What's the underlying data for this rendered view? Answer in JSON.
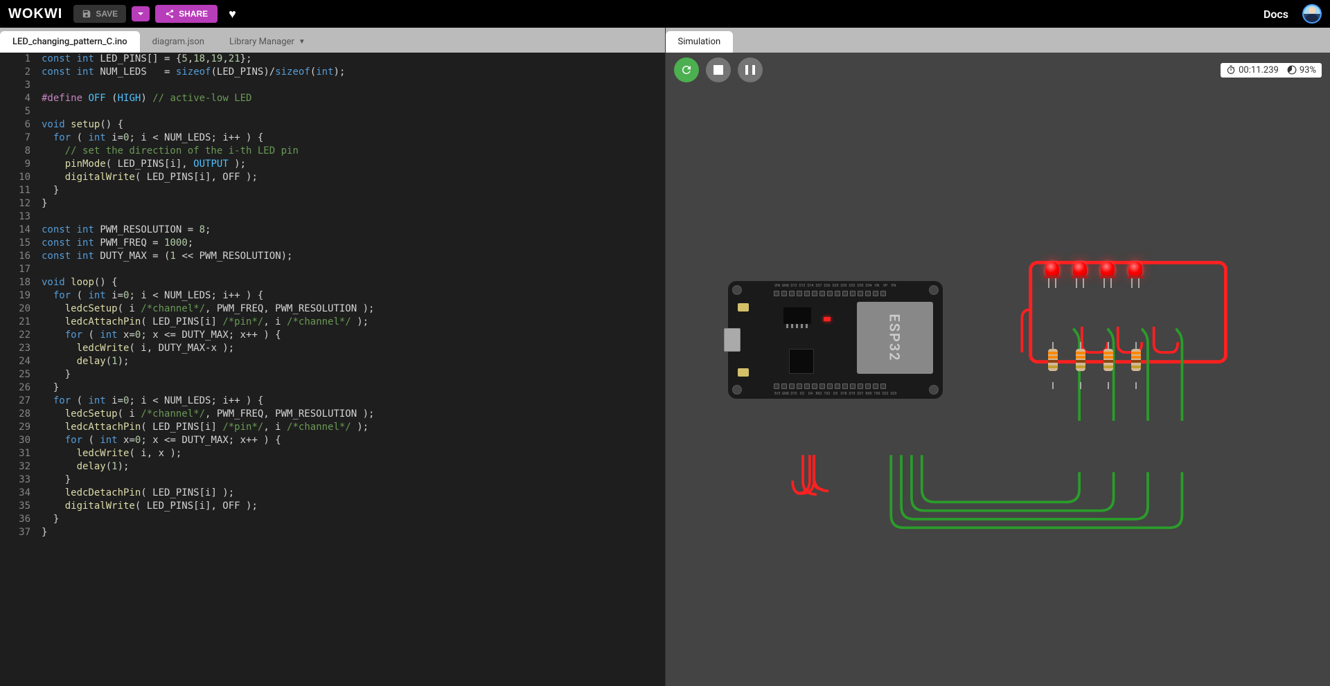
{
  "topbar": {
    "logo": "WOKWI",
    "save_label": "SAVE",
    "share_label": "SHARE",
    "docs_label": "Docs"
  },
  "tabs": {
    "file_active": "LED_changing_pattern_C.ino",
    "file_2": "diagram.json",
    "library": "Library Manager"
  },
  "simulation": {
    "tab_label": "Simulation",
    "time": "00:11.239",
    "perf": "93%"
  },
  "board": {
    "chip_label": "ESP32",
    "pins_top": [
      "VIN",
      "GND",
      "D13",
      "D12",
      "D14",
      "D27",
      "D26",
      "D25",
      "D33",
      "D32",
      "D35",
      "D34",
      "VN",
      "VP",
      "EN"
    ],
    "pins_bot": [
      "3V3",
      "GND",
      "D15",
      "D2",
      "D4",
      "RX2",
      "TX2",
      "D5",
      "D18",
      "D19",
      "D21",
      "RX0",
      "TX0",
      "D22",
      "D23"
    ]
  },
  "code": [
    {
      "n": 1,
      "h": "<span class='kw'>const</span> <span class='type'>int</span> LED_PINS[] = {<span class='num'>5</span>,<span class='num'>18</span>,<span class='num'>19</span>,<span class='num'>21</span>};"
    },
    {
      "n": 2,
      "h": "<span class='kw'>const</span> <span class='type'>int</span> NUM_LEDS   = <span class='kw'>sizeof</span>(LED_PINS)/<span class='kw'>sizeof</span>(<span class='type'>int</span>);"
    },
    {
      "n": 3,
      "h": ""
    },
    {
      "n": 4,
      "h": "<span class='mac'>#define</span> <span class='const'>OFF</span> (<span class='const'>HIGH</span>) <span class='cmt'>// active-low LED</span>"
    },
    {
      "n": 5,
      "h": ""
    },
    {
      "n": 6,
      "h": "<span class='type'>void</span> <span class='fn'>setup</span>() {"
    },
    {
      "n": 7,
      "h": "  <span class='kw'>for</span> ( <span class='type'>int</span> i=<span class='num'>0</span>; i &lt; NUM_LEDS; i++ ) {"
    },
    {
      "n": 8,
      "h": "    <span class='cmt'>// set the direction of the i-th LED pin</span>"
    },
    {
      "n": 9,
      "h": "    <span class='fn'>pinMode</span>( LED_PINS[i], <span class='const'>OUTPUT</span> );"
    },
    {
      "n": 10,
      "h": "    <span class='fn'>digitalWrite</span>( LED_PINS[i], OFF );"
    },
    {
      "n": 11,
      "h": "  }"
    },
    {
      "n": 12,
      "h": "}"
    },
    {
      "n": 13,
      "h": ""
    },
    {
      "n": 14,
      "h": "<span class='kw'>const</span> <span class='type'>int</span> PWM_RESOLUTION = <span class='num'>8</span>;"
    },
    {
      "n": 15,
      "h": "<span class='kw'>const</span> <span class='type'>int</span> PWM_FREQ = <span class='num'>1000</span>;"
    },
    {
      "n": 16,
      "h": "<span class='kw'>const</span> <span class='type'>int</span> DUTY_MAX = (<span class='num'>1</span> &lt;&lt; PWM_RESOLUTION);"
    },
    {
      "n": 17,
      "h": ""
    },
    {
      "n": 18,
      "h": "<span class='type'>void</span> <span class='fn'>loop</span>() {"
    },
    {
      "n": 19,
      "h": "  <span class='kw'>for</span> ( <span class='type'>int</span> i=<span class='num'>0</span>; i &lt; NUM_LEDS; i++ ) {"
    },
    {
      "n": 20,
      "h": "    <span class='fn'>ledcSetup</span>( i <span class='cmt'>/*channel*/</span>, PWM_FREQ, PWM_RESOLUTION );"
    },
    {
      "n": 21,
      "h": "    <span class='fn'>ledcAttachPin</span>( LED_PINS[i] <span class='cmt'>/*pin*/</span>, i <span class='cmt'>/*channel*/</span> );"
    },
    {
      "n": 22,
      "h": "    <span class='kw'>for</span> ( <span class='type'>int</span> x=<span class='num'>0</span>; x &lt;= DUTY_MAX; x++ ) {"
    },
    {
      "n": 23,
      "h": "      <span class='fn'>ledcWrite</span>( i, DUTY_MAX-x );"
    },
    {
      "n": 24,
      "h": "      <span class='fn'>delay</span>(<span class='num'>1</span>);"
    },
    {
      "n": 25,
      "h": "    }"
    },
    {
      "n": 26,
      "h": "  }"
    },
    {
      "n": 27,
      "h": "  <span class='kw'>for</span> ( <span class='type'>int</span> i=<span class='num'>0</span>; i &lt; NUM_LEDS; i++ ) {"
    },
    {
      "n": 28,
      "h": "    <span class='fn'>ledcSetup</span>( i <span class='cmt'>/*channel*/</span>, PWM_FREQ, PWM_RESOLUTION );"
    },
    {
      "n": 29,
      "h": "    <span class='fn'>ledcAttachPin</span>( LED_PINS[i] <span class='cmt'>/*pin*/</span>, i <span class='cmt'>/*channel*/</span> );"
    },
    {
      "n": 30,
      "h": "    <span class='kw'>for</span> ( <span class='type'>int</span> x=<span class='num'>0</span>; x &lt;= DUTY_MAX; x++ ) {"
    },
    {
      "n": 31,
      "h": "      <span class='fn'>ledcWrite</span>( i, x );"
    },
    {
      "n": 32,
      "h": "      <span class='fn'>delay</span>(<span class='num'>1</span>);"
    },
    {
      "n": 33,
      "h": "    }"
    },
    {
      "n": 34,
      "h": "    <span class='fn'>ledcDetachPin</span>( LED_PINS[i] );"
    },
    {
      "n": 35,
      "h": "    <span class='fn'>digitalWrite</span>( LED_PINS[i], OFF );"
    },
    {
      "n": 36,
      "h": "  }"
    },
    {
      "n": 37,
      "h": "}"
    }
  ]
}
